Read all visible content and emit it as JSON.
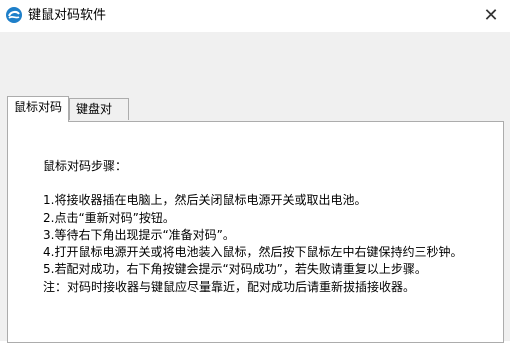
{
  "window": {
    "title": "键鼠对码软件",
    "close_glyph": "✕"
  },
  "tabs": [
    {
      "label": "鼠标对码",
      "active": true
    },
    {
      "label": "键盘对码",
      "active": false
    }
  ],
  "instructions": {
    "heading": "鼠标对码步骤：",
    "steps": [
      "1.将接收器插在电脑上，然后关闭鼠标电源开关或取出电池。",
      "2.点击“重新对码”按钮。",
      "3.等待右下角出现提示“准备对码”。",
      "4.打开鼠标电源开关或将电池装入鼠标，然后按下鼠标左中右键保持约三秒钟。",
      "5.若配对成功，右下角按键会提示“对码成功”，若失败请重复以上步骤。",
      "注：对码时接收器与键鼠应尽量靠近，配对成功后请重新拔插接收器。"
    ]
  },
  "colors": {
    "window_bg": "#f0f0f0",
    "panel_bg": "#ffffff",
    "icon_accent": "#1e7fc9"
  },
  "icons": {
    "app": "app-logo-icon",
    "close": "close-icon"
  }
}
